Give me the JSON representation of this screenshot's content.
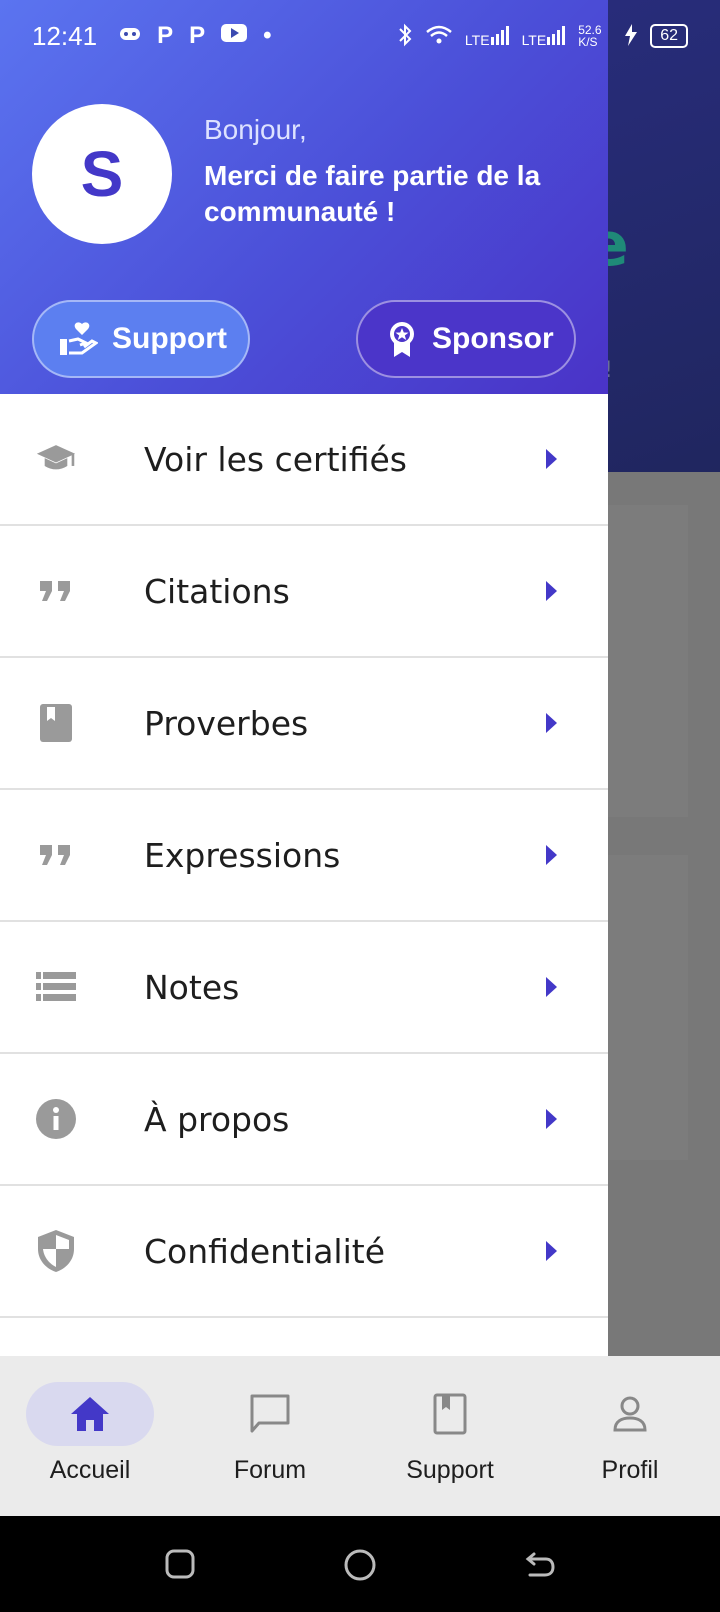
{
  "status_bar": {
    "time": "12:41",
    "app_icons": [
      "game-icon",
      "p-icon",
      "p-icon",
      "youtube-icon"
    ],
    "network_speed": "52.6 K/S",
    "lte1": "LTE",
    "lte2": "LTE",
    "battery": "62"
  },
  "drawer": {
    "avatar_letter": "S",
    "greeting": "Bonjour,",
    "welcome": "Merci de faire partie de la communauté !",
    "support_button": "Support",
    "sponsor_button": "Sponsor",
    "items": [
      {
        "label": "Voir les certifiés",
        "icon": "graduation-cap-icon"
      },
      {
        "label": "Citations",
        "icon": "quote-icon"
      },
      {
        "label": "Proverbes",
        "icon": "book-icon"
      },
      {
        "label": "Expressions",
        "icon": "quote-icon"
      },
      {
        "label": "Notes",
        "icon": "list-icon"
      },
      {
        "label": "À propos",
        "icon": "info-icon"
      },
      {
        "label": "Confidentialité",
        "icon": "shield-icon"
      }
    ]
  },
  "bottom_nav": {
    "items": [
      {
        "label": "Accueil",
        "icon": "home-icon",
        "active": true
      },
      {
        "label": "Forum",
        "icon": "chat-icon",
        "active": false
      },
      {
        "label": "Support",
        "icon": "bookmark-book-icon",
        "active": false
      },
      {
        "label": "Profil",
        "icon": "user-icon",
        "active": false
      }
    ]
  },
  "colors": {
    "accent": "#4338c8",
    "header_start": "#5b74f0",
    "header_end": "#4a33c7",
    "icon_gray": "#9a9a9a"
  }
}
